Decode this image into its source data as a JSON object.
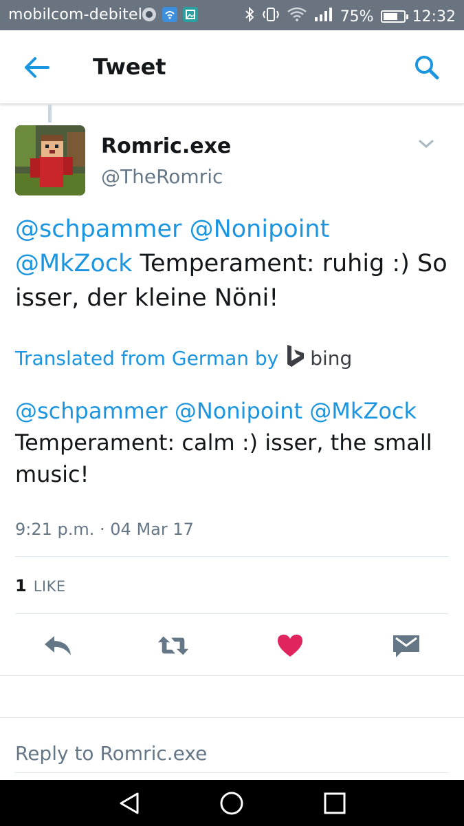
{
  "status_bar": {
    "carrier": "mobilcom-debitel",
    "battery": "75%",
    "battery_level": 0.75,
    "time": "12:32"
  },
  "app_bar": {
    "title": "Tweet",
    "back_icon": "arrow-left-icon",
    "search_icon": "search-icon"
  },
  "tweet": {
    "author_name": "Romric.exe",
    "author_handle": "@TheRomric",
    "mentions": [
      "@schpammer",
      "@Nonipoint",
      "@MkZock"
    ],
    "text": "Temperament: ruhig :) So isser, der kleine Nöni!",
    "translated_from": "Translated from German by",
    "translator_brand": "bing",
    "translation_mentions": [
      "@schpammer",
      "@Nonipoint",
      "@MkZock"
    ],
    "translation_text": "Temperament: calm :) isser, the small music!",
    "timestamp": "9:21 p.m. · 04 Mar 17",
    "like_count": "1",
    "like_label": "LIKE"
  },
  "actions": [
    {
      "name": "reply-icon",
      "color": "#657786"
    },
    {
      "name": "retweet-icon",
      "color": "#657786"
    },
    {
      "name": "heart-icon",
      "color": "#e0245e"
    },
    {
      "name": "direct-message-icon",
      "color": "#657786"
    }
  ],
  "reply_box": {
    "placeholder": "Reply to Romric.exe"
  },
  "colors": {
    "accent": "#1b95e0",
    "like": "#e0245e",
    "secondary_text": "#657786",
    "status_bar": "#6a7480"
  }
}
